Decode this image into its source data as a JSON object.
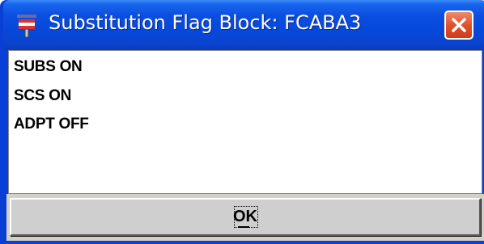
{
  "window": {
    "title": "Substitution Flag Block: FCABA3",
    "icon": "app-icon",
    "close_icon": "close-icon",
    "titlebar_color": "#0548db",
    "close_color": "#e0512d"
  },
  "content": {
    "lines": [
      "SUBS ON",
      "SCS ON",
      "ADPT OFF"
    ]
  },
  "buttons": {
    "ok_label": "OK",
    "ok_mnemonic": "O"
  }
}
